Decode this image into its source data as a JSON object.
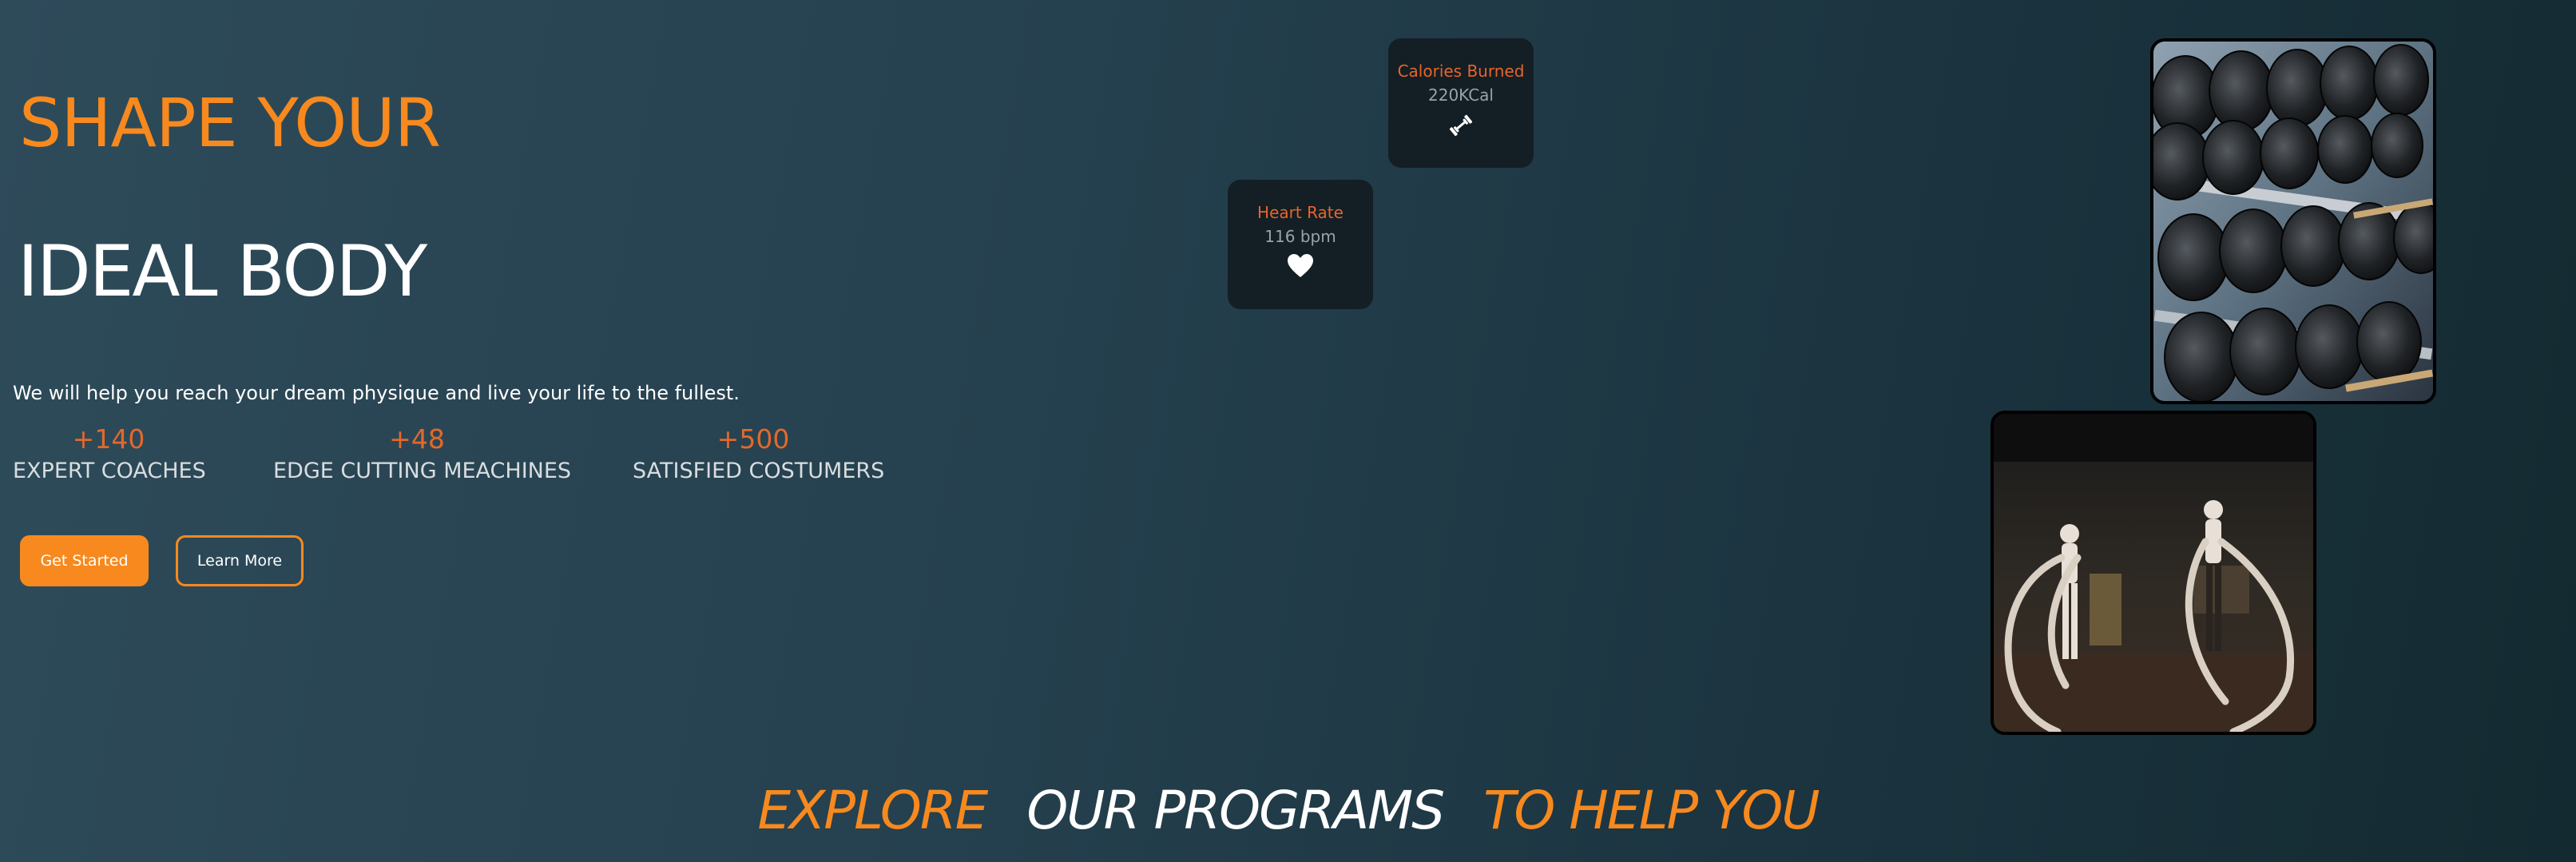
{
  "hero": {
    "title_line1": "SHAPE YOUR",
    "title_line2": "IDEAL BODY",
    "subtitle": "We will help you reach your dream physique and live your life to the fullest."
  },
  "stats": [
    {
      "value": "+140",
      "label": "EXPERT COACHES"
    },
    {
      "value": "+48",
      "label": "EDGE CUTTING MEACHINES"
    },
    {
      "value": "+500",
      "label": "SATISFIED COSTUMERS"
    }
  ],
  "buttons": {
    "get_started": "Get Started",
    "learn_more": "Learn More"
  },
  "cards": {
    "calories": {
      "title": "Calories Burned",
      "value": "220KCal",
      "icon": "dumbbell-icon"
    },
    "heart_rate": {
      "title": "Heart Rate",
      "value": "116 bpm",
      "icon": "heart-icon"
    }
  },
  "images": {
    "dumbbells": "dumbbell-rack-photo",
    "battle_ropes": "battle-ropes-photo"
  },
  "programs_heading": {
    "part1": "EXPLORE",
    "part2": "OUR PROGRAMS",
    "part3": "TO HELP YOU"
  },
  "colors": {
    "accent": "#f7891e",
    "stat_accent": "#e4682b",
    "card_bg": "#131f24",
    "background_start": "#2e4b5a",
    "background_end": "#142a31"
  }
}
